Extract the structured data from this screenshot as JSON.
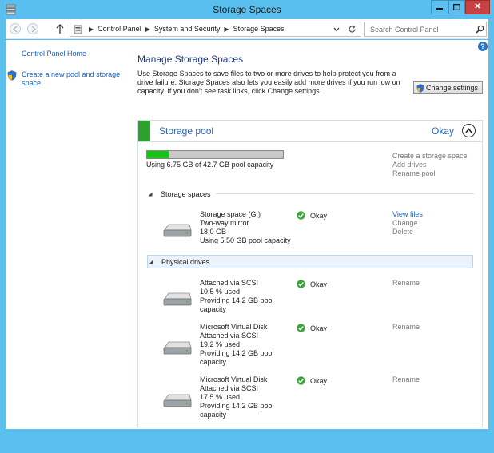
{
  "window": {
    "title": "Storage Spaces"
  },
  "address": {
    "breadcrumbs": [
      "Control Panel",
      "System and Security",
      "Storage Spaces"
    ],
    "search_placeholder": "Search Control Panel"
  },
  "nav": {
    "home": "Control Panel Home",
    "create_pool": "Create a new pool and storage space"
  },
  "main": {
    "title": "Manage Storage Spaces",
    "description": "Use Storage Spaces to save files to two or more drives to help protect you from a drive failure. Storage Spaces also lets you easily add more drives if you run low on capacity. If you don't see task links, click Change settings.",
    "change_settings": "Change settings"
  },
  "pool": {
    "title": "Storage pool",
    "status": "Okay",
    "capacity_text": "Using 6.75 GB of 42.7 GB pool capacity",
    "used_fraction": 0.158,
    "actions": [
      "Create a storage space",
      "Add drives",
      "Rename pool"
    ]
  },
  "storage_spaces": {
    "label": "Storage spaces",
    "items": [
      {
        "lines": [
          "Storage space (G:)",
          "Two-way mirror",
          "18.0 GB",
          "Using 5.50 GB pool capacity"
        ],
        "status": "Okay",
        "actions": [
          "View files",
          "Change",
          "Delete"
        ]
      }
    ]
  },
  "physical_drives": {
    "label": "Physical drives",
    "items": [
      {
        "lines": [
          "Attached via SCSI",
          "10.5 % used",
          "Providing 14.2 GB pool",
          "capacity"
        ],
        "status": "Okay",
        "action": "Rename"
      },
      {
        "lines": [
          "Microsoft Virtual Disk",
          "Attached via SCSI",
          "19.2 % used",
          "Providing 14.2 GB pool",
          "capacity"
        ],
        "status": "Okay",
        "action": "Rename"
      },
      {
        "lines": [
          "Microsoft Virtual Disk",
          "Attached via SCSI",
          "17.5 % used",
          "Providing 14.2 GB pool",
          "capacity"
        ],
        "status": "Okay",
        "action": "Rename"
      }
    ]
  },
  "colors": {
    "accent": "#59bfee",
    "link": "#1b5fbf",
    "pool_ok": "#2da12d",
    "capacity_fill": "#16c316"
  },
  "icons": [
    "storage-spaces-icon",
    "back-arrow-icon",
    "forward-arrow-icon",
    "up-arrow-icon",
    "control-panel-icon",
    "refresh-icon",
    "search-icon",
    "help-icon",
    "shield-icon",
    "collapse-chevron-icon",
    "disk-drive-icon",
    "ok-check-icon"
  ]
}
